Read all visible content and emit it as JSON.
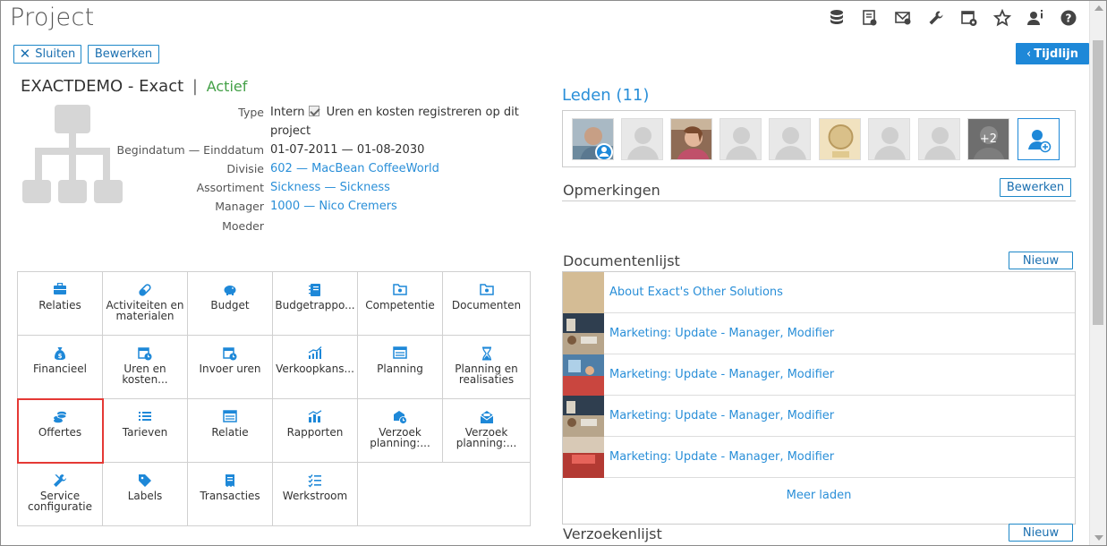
{
  "page": {
    "title": "Project"
  },
  "toolbar": {
    "close_label": "Sluiten",
    "edit_label": "Bewerken",
    "timeline_label": "Tijdlijn",
    "icons": [
      "database-icon",
      "report-icon",
      "mail-icon",
      "wrench-icon",
      "calendar-settings-icon",
      "star-icon",
      "user-info-icon",
      "help-icon"
    ]
  },
  "project": {
    "name": "EXACTDEMO - Exact",
    "separator": "|",
    "status": "Actief",
    "status_color": "#43a047"
  },
  "properties": {
    "type_label": "Type",
    "type_value": "Intern",
    "type_checkbox_text_1": "Uren en kosten registreren op dit",
    "type_checkbox_text_2": "project",
    "dates_label": "Begindatum — Einddatum",
    "dates_value": "01-07-2011 — 01-08-2030",
    "division_label": "Divisie",
    "division_value": "602 — MacBean CoffeeWorld",
    "assortment_label": "Assortiment",
    "assortment_value": "Sickness — Sickness",
    "manager_label": "Manager",
    "manager_value": "1000 — Nico Cremers",
    "parent_label": "Moeder"
  },
  "tiles": [
    {
      "label": "Relaties",
      "icon": "briefcase-icon"
    },
    {
      "label": "Activiteiten en materialen",
      "icon": "pill-icon"
    },
    {
      "label": "Budget",
      "icon": "piggy-bank-icon"
    },
    {
      "label": "Budgetrappo...",
      "icon": "notebook-icon"
    },
    {
      "label": "Competentie",
      "icon": "folder-icon"
    },
    {
      "label": "Documenten",
      "icon": "folder-icon"
    },
    {
      "label": "Financieel",
      "icon": "money-bag-icon"
    },
    {
      "label": "Uren en kosten...",
      "icon": "clock-calendar-icon"
    },
    {
      "label": "Invoer uren",
      "icon": "clock-calendar-icon"
    },
    {
      "label": "Verkoopkans...",
      "icon": "chart-icon"
    },
    {
      "label": "Planning",
      "icon": "list-icon"
    },
    {
      "label": "Planning en realisaties",
      "icon": "hourglass-icon"
    },
    {
      "label": "Offertes",
      "icon": "coins-icon"
    },
    {
      "label": "Tarieven",
      "icon": "bullet-list-icon"
    },
    {
      "label": "Relatie",
      "icon": "list-icon"
    },
    {
      "label": "Rapporten",
      "icon": "bar-chart-icon"
    },
    {
      "label": "Verzoek planning:...",
      "icon": "request-icon"
    },
    {
      "label": "Verzoek planning:...",
      "icon": "envelope-open-icon"
    },
    {
      "label": "Service configuratie",
      "icon": "tools-icon"
    },
    {
      "label": "Labels",
      "icon": "tag-icon"
    },
    {
      "label": "Transacties",
      "icon": "receipt-icon"
    },
    {
      "label": "Werkstroom",
      "icon": "checklist-icon"
    }
  ],
  "members": {
    "title": "Leden (11)",
    "extra_count": "+2",
    "add_icon": "add-user-icon"
  },
  "remarks": {
    "title": "Opmerkingen",
    "edit_label": "Bewerken"
  },
  "documents": {
    "title": "Documentenlijst",
    "new_label": "Nieuw",
    "items": [
      "About Exact's Other Solutions",
      "Marketing: Update - Manager, Modifier",
      "Marketing: Update - Manager, Modifier",
      "Marketing: Update - Manager, Modifier",
      "Marketing: Update - Manager, Modifier"
    ],
    "more_label": "Meer laden"
  },
  "requests": {
    "title": "Verzoekenlijst",
    "new_label": "Nieuw"
  },
  "colors": {
    "accent": "#2a8fd8",
    "selected_outline": "#e53935"
  }
}
